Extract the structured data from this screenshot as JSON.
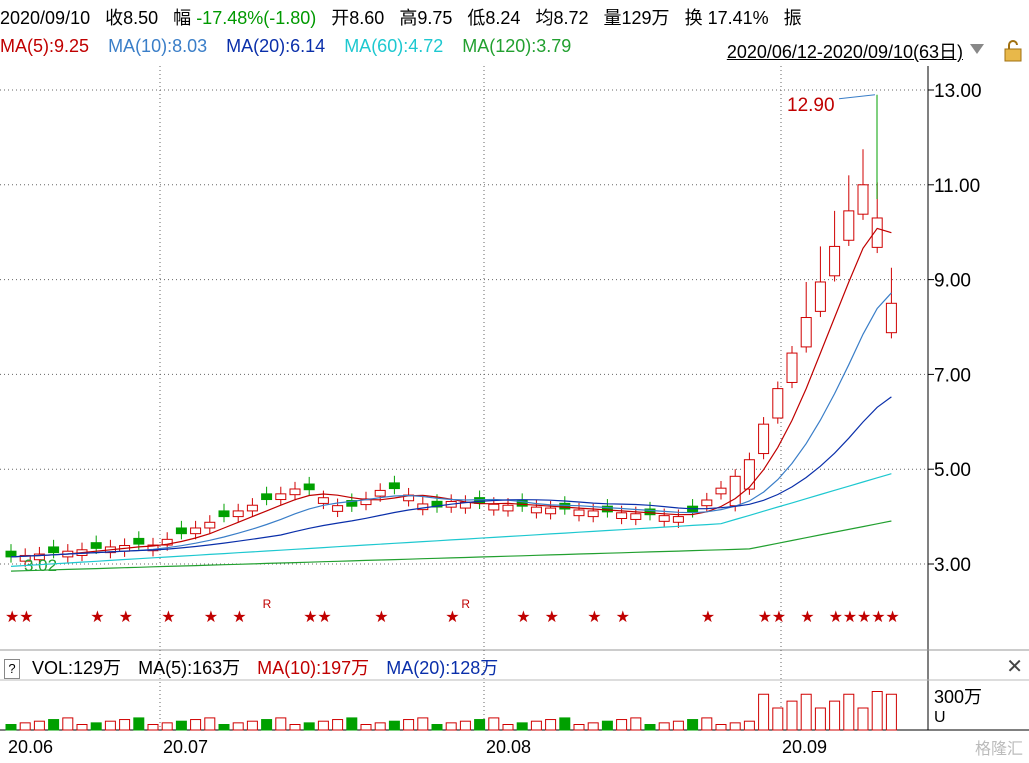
{
  "header": {
    "date": "2020/09/10",
    "close_label": "收",
    "close_value": "8.50",
    "change_label": "幅",
    "change_value": "-17.48%(-1.80)",
    "open_label": "开",
    "open_value": "8.60",
    "high_label": "高",
    "high_value": "9.75",
    "low_label": "低",
    "low_value": "8.24",
    "avg_label": "均",
    "avg_value": "8.72",
    "volume_label": "量",
    "volume_value": "129万",
    "turnover_label": "换",
    "turnover_value": "17.41%",
    "amplitude_label": "振"
  },
  "ma": {
    "ma5": "MA(5):9.25",
    "ma10": "MA(10):8.03",
    "ma20": "MA(20):6.14",
    "ma60": "MA(60):4.72",
    "ma120": "MA(120):3.79"
  },
  "range": "2020/06/12-2020/09/10(63日)",
  "vol_panel": {
    "help": "?",
    "vol": "VOL:129万",
    "ma5": "MA(5):163万",
    "ma10": "MA(10):197万",
    "ma20": "MA(20):128万",
    "axis_label": "300万",
    "unit": "U"
  },
  "chart_data": {
    "type": "candlestick",
    "y_ticks": [
      "13.00",
      "11.00",
      "9.00",
      "7.00",
      "5.00",
      "3.00"
    ],
    "x_labels": [
      "20.06",
      "20.07",
      "20.08",
      "20.09"
    ],
    "annotations": {
      "max": "12.90",
      "min": "3.02"
    }
  },
  "colors": {
    "up": "#d00000",
    "down": "#00a000",
    "ma5": "#c00000",
    "ma10": "#3a7ec8",
    "ma20": "#0a2faa",
    "ma60": "#1ec8d0",
    "ma120": "#22a030"
  },
  "watermark": "格隆汇"
}
